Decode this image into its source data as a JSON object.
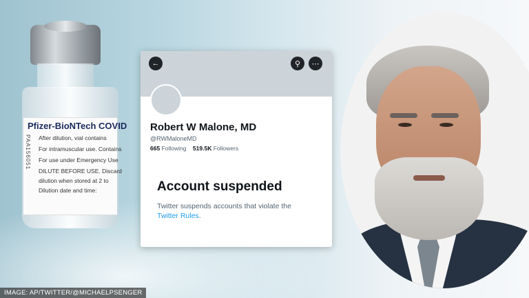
{
  "image_credit": "IMAGE: AP/TWITTER/@MICHAELPSENGER",
  "vial": {
    "brand": "Pfizer-BioNTech COVID",
    "label_lines": [
      "After dilution, vial contains",
      "For intramuscular use. Contains",
      "For use under Emergency Use",
      "DILUTE BEFORE USE. Discard",
      "dilution when stored at 2 to",
      "Dilution date and time:"
    ],
    "lot_code": "PAA156051"
  },
  "twitter_profile": {
    "icons": {
      "back": "arrow-left-icon",
      "search": "search-icon",
      "more": "more-icon"
    },
    "display_name": "Robert W Malone, MD",
    "handle": "@RWMaloneMD",
    "following_count": "665",
    "following_label": "Following",
    "followers_count": "519.5K",
    "followers_label": "Followers",
    "suspended_title": "Account suspended",
    "suspended_text": "Twitter suspends accounts that violate the",
    "rules_link": "Twitter Rules",
    "rules_suffix": "."
  }
}
